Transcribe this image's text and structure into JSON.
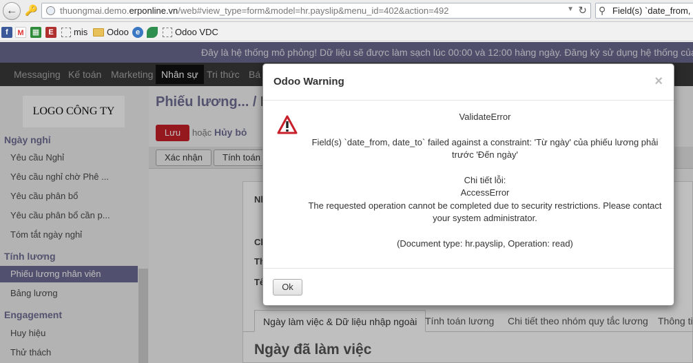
{
  "browser": {
    "url_prefix": "thuongmai.demo.",
    "url_domain": "erponline.vn",
    "url_path": "/web#view_type=form&model=hr.payslip&menu_id=402&action=492",
    "search_value": "Field(s) `date_from, date_to` failed"
  },
  "bookmarks": [
    {
      "label": ""
    },
    {
      "label": ""
    },
    {
      "label": ""
    },
    {
      "label": ""
    },
    {
      "label": "mis"
    },
    {
      "label": "Odoo"
    },
    {
      "label": ""
    },
    {
      "label": ""
    },
    {
      "label": "Odoo VDC"
    }
  ],
  "notice": "Đây là hệ thống mô phỏng! Dữ liệu sẽ được làm sạch lúc 00:00 và 12:00 hàng ngày. Đăng ký sử dụng hệ thống của riêng bạn",
  "topmenu": [
    "Messaging",
    "Kế toán",
    "Marketing",
    "Nhân sự",
    "Tri thức",
    "Bá"
  ],
  "sidebar": {
    "logo": "LOGO CÔNG TY",
    "sections": [
      {
        "title": "Ngày nghỉ",
        "items": [
          "Yêu cầu Nghỉ",
          "Yêu cầu nghỉ chờ Phê ...",
          "Yêu cầu phân bổ",
          "Yêu cầu phân bổ cần p...",
          "Tóm tắt ngày nghỉ"
        ]
      },
      {
        "title": "Tính lương",
        "items": [
          "Phiếu lương nhân viên",
          "Bảng lương"
        ]
      },
      {
        "title": "Engagement",
        "items": [
          "Huy hiệu",
          "Thử thách"
        ]
      }
    ]
  },
  "main": {
    "breadcrumb": "Phiếu lương... /",
    "breadcrumb_current": "M",
    "save": "Lưu",
    "or": "hoặc",
    "discard": "Hủy bỏ",
    "status_buttons": [
      "Xác nhận",
      "Tính toán"
    ],
    "sheet_labels": [
      "Nh",
      "Ch",
      "Th",
      "Tê"
    ],
    "tabs": [
      "Ngày làm việc & Dữ liệu nhập ngoài",
      "Tính toán lương",
      "Chi tiết theo nhóm quy tắc lương",
      "Thông tin"
    ],
    "section_title": "Ngày đã làm việc"
  },
  "modal": {
    "title": "Odoo Warning",
    "close": "×",
    "error_type": "ValidateError",
    "line1": "Field(s) `date_from, date_to` failed against a constraint: 'Từ ngày' của phiếu lương phải",
    "line2": "trước 'Đến ngày'",
    "detail_label": "Chi tiết lỗi:",
    "detail_type": "AccessError",
    "detail_line1": "The requested operation cannot be completed due to security restrictions. Please contact",
    "detail_line2": "your system administrator.",
    "document": "(Document type: hr.payslip, Operation: read)",
    "ok": "Ok",
    "colors": {
      "warning": "#c8202a"
    }
  }
}
